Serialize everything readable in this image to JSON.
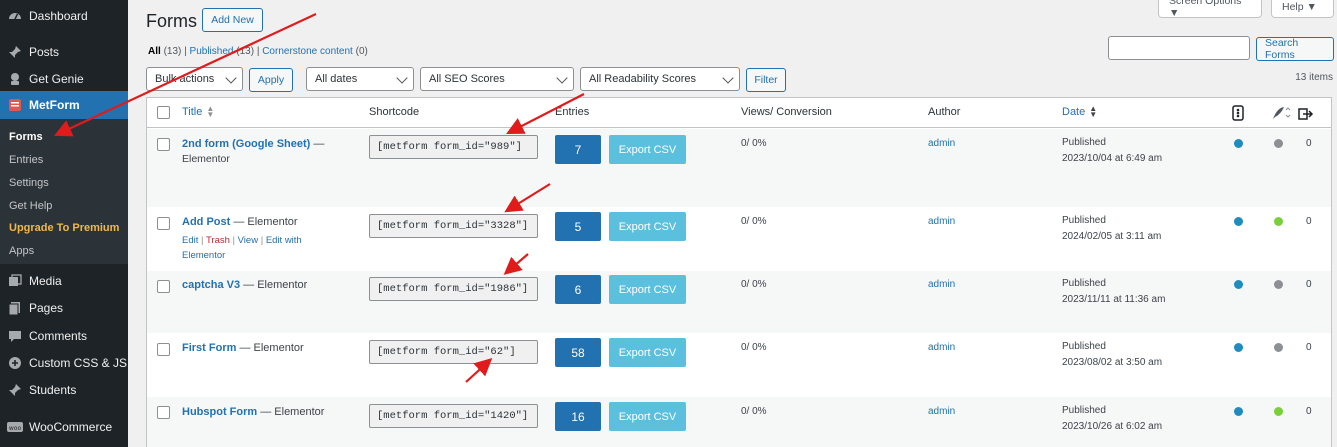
{
  "sidebar": {
    "items": [
      {
        "label": "Dashboard",
        "icon": "dashboard-icon"
      },
      {
        "label": "Posts",
        "icon": "pin-icon"
      },
      {
        "label": "Get Genie",
        "icon": "genie-icon"
      },
      {
        "label": "MetForm",
        "icon": "metform-icon"
      },
      {
        "label": "Media",
        "icon": "media-icon"
      },
      {
        "label": "Pages",
        "icon": "pages-icon"
      },
      {
        "label": "Comments",
        "icon": "comments-icon"
      },
      {
        "label": "Custom CSS & JS",
        "icon": "plus-circle-icon"
      },
      {
        "label": "Students",
        "icon": "pin-icon"
      },
      {
        "label": "WooCommerce",
        "icon": "woo-icon"
      }
    ],
    "submenu": [
      "Forms",
      "Entries",
      "Settings",
      "Get Help",
      "Upgrade To Premium",
      "Apps"
    ]
  },
  "header": {
    "title": "Forms",
    "add_new": "Add New",
    "screen_options": "Screen Options ▼",
    "help": "Help ▼"
  },
  "views": {
    "all": "All",
    "all_count": "(13)",
    "published": "Published",
    "published_count": "(13)",
    "cornerstone": "Cornerstone content",
    "cornerstone_count": "(0)",
    "sep": "|"
  },
  "filters": {
    "bulk": "Bulk actions",
    "apply": "Apply",
    "dates": "All dates",
    "seo": "All SEO Scores",
    "readability": "All Readability Scores",
    "filter": "Filter",
    "search_button": "Search Forms",
    "items": "13 items"
  },
  "columns": {
    "title": "Title",
    "shortcode": "Shortcode",
    "entries": "Entries",
    "views": "Views/ Conversion",
    "author": "Author",
    "date": "Date"
  },
  "rows": [
    {
      "title": "2nd form (Google Sheet)",
      "suffix": " —",
      "line2": "Elementor",
      "shortcode": "[metform form_id=\"989\"]",
      "entries": "7",
      "export": "Export CSV",
      "views": "0/ 0%",
      "author": "admin",
      "status": "Published",
      "date": "2023/10/04 at 6:49 am",
      "seo": "#1e8cbe",
      "read": "#8c8f94",
      "links": "0"
    },
    {
      "title": "Add Post",
      "suffix": " — Elementor",
      "line2": "",
      "shortcode": "[metform form_id=\"3328\"]",
      "entries": "5",
      "export": "Export CSV",
      "views": "0/ 0%",
      "author": "admin",
      "status": "Published",
      "date": "2024/02/05 at 3:11 am",
      "seo": "#1e8cbe",
      "read": "#7ad03a",
      "links": "0"
    },
    {
      "title": "captcha V3",
      "suffix": " — Elementor",
      "line2": "",
      "shortcode": "[metform form_id=\"1986\"]",
      "entries": "6",
      "export": "Export CSV",
      "views": "0/ 0%",
      "author": "admin",
      "status": "Published",
      "date": "2023/11/11 at 11:36 am",
      "seo": "#1e8cbe",
      "read": "#8c8f94",
      "links": "0"
    },
    {
      "title": "First Form",
      "suffix": " — Elementor",
      "line2": "",
      "shortcode": "[metform form_id=\"62\"]",
      "entries": "58",
      "export": "Export CSV",
      "views": "0/ 0%",
      "author": "admin",
      "status": "Published",
      "date": "2023/08/02 at 3:50 am",
      "seo": "#1e8cbe",
      "read": "#8c8f94",
      "links": "0"
    },
    {
      "title": "Hubspot Form",
      "suffix": " — Elementor",
      "line2": "",
      "shortcode": "[metform form_id=\"1420\"]",
      "entries": "16",
      "export": "Export CSV",
      "views": "0/ 0%",
      "author": "admin",
      "status": "Published",
      "date": "2023/10/26 at 6:02 am",
      "seo": "#1e8cbe",
      "read": "#7ad03a",
      "links": "0"
    }
  ],
  "row_actions": {
    "edit": "Edit",
    "trash": "Trash",
    "view": "View",
    "edit_with": "Edit with",
    "elementor": "Elementor",
    "sep": "|"
  },
  "colors": {
    "accent": "#2271b1",
    "sidebar": "#1d2327",
    "annotation": "#e01b1b",
    "export": "#5bc0de"
  }
}
